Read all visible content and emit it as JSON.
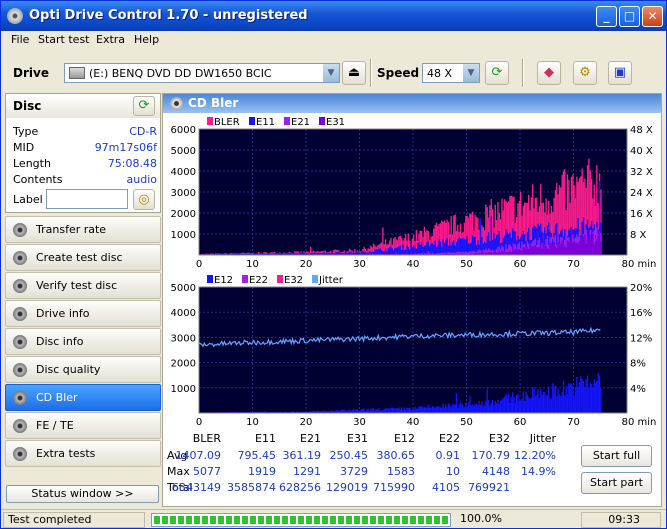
{
  "window": {
    "title": "Opti Drive Control 1.70 - unregistered",
    "min": "_",
    "max": "□",
    "close": "✕"
  },
  "menu": [
    "File",
    "Start test",
    "Extra",
    "Help"
  ],
  "toolbar": {
    "drive_label": "Drive",
    "drive_value": "(E:)  BENQ DVD DD DW1650 BCIC",
    "speed_label": "Speed",
    "speed_value": "48 X"
  },
  "disc": {
    "title": "Disc",
    "rows": [
      {
        "k": "Type",
        "v": "CD-R"
      },
      {
        "k": "MID",
        "v": "97m17s06f"
      },
      {
        "k": "Length",
        "v": "75:08.48"
      },
      {
        "k": "Contents",
        "v": "audio"
      }
    ],
    "label_caption": "Label",
    "label_value": ""
  },
  "nav": [
    "Transfer rate",
    "Create test disc",
    "Verify test disc",
    "Drive info",
    "Disc info",
    "Disc quality",
    "CD Bler",
    "FE / TE",
    "Extra tests"
  ],
  "nav_active": 6,
  "status_window_button": "Status window >>",
  "panel_title": "CD Bler",
  "chart_data": [
    {
      "type": "area",
      "legend": [
        "BLER",
        "E11",
        "E21",
        "E31"
      ],
      "colors": [
        "#ff1a8c",
        "#1414ff",
        "#a020f0",
        "#7b00d6"
      ],
      "x_ticks": [
        "0",
        "10",
        "20",
        "30",
        "40",
        "50",
        "60",
        "70",
        "80 min"
      ],
      "y_ticks": [
        "6000",
        "5000",
        "4000",
        "3000",
        "2000",
        "1000"
      ],
      "y2_ticks": [
        "48 X",
        "40 X",
        "32 X",
        "24 X",
        "16 X",
        "8 X"
      ],
      "xlim": [
        0,
        80
      ],
      "ylim": [
        0,
        6000
      ],
      "series": [
        {
          "name": "BLER",
          "x": [
            0,
            10,
            20,
            30,
            35,
            40,
            45,
            50,
            55,
            60,
            65,
            70,
            75
          ],
          "y": [
            50,
            100,
            150,
            250,
            600,
            900,
            1300,
            1700,
            2100,
            2500,
            2900,
            3300,
            3800
          ]
        },
        {
          "name": "E11",
          "x": [
            0,
            10,
            20,
            30,
            35,
            40,
            45,
            50,
            55,
            60,
            65,
            70,
            75
          ],
          "y": [
            30,
            60,
            100,
            150,
            300,
            450,
            600,
            750,
            900,
            1050,
            1200,
            1350,
            1500
          ]
        },
        {
          "name": "E21",
          "x": [
            0,
            30,
            40,
            50,
            55,
            60,
            65,
            70,
            75
          ],
          "y": [
            0,
            20,
            60,
            150,
            300,
            500,
            700,
            900,
            1100
          ]
        },
        {
          "name": "E31",
          "x": [
            0,
            50,
            55,
            60,
            65,
            70,
            75
          ],
          "y": [
            0,
            50,
            150,
            300,
            450,
            650,
            900
          ]
        }
      ]
    },
    {
      "type": "area",
      "legend": [
        "E12",
        "E22",
        "E32",
        "Jitter"
      ],
      "colors": [
        "#1414ff",
        "#a020f0",
        "#ff1a8c",
        "#5fa8ff"
      ],
      "x_ticks": [
        "0",
        "10",
        "20",
        "30",
        "40",
        "50",
        "60",
        "70",
        "80 min"
      ],
      "y_ticks": [
        "5000",
        "4000",
        "3000",
        "2000",
        "1000"
      ],
      "y2_ticks": [
        "20%",
        "16%",
        "12%",
        "8%",
        "4%"
      ],
      "xlim": [
        0,
        80
      ],
      "ylim": [
        0,
        5000
      ],
      "series": [
        {
          "name": "E12",
          "x": [
            0,
            20,
            40,
            50,
            55,
            60,
            65,
            70,
            75
          ],
          "y": [
            20,
            60,
            200,
            350,
            500,
            700,
            900,
            1100,
            1400
          ]
        },
        {
          "name": "Jitter",
          "x": [
            0,
            10,
            20,
            30,
            40,
            50,
            60,
            70,
            75
          ],
          "y": [
            10.8,
            11.2,
            11.5,
            11.8,
            12.2,
            12.4,
            12.6,
            12.8,
            13.2
          ]
        }
      ]
    }
  ],
  "stats": {
    "headers": [
      "BLER",
      "E11",
      "E21",
      "E31",
      "E12",
      "E22",
      "E32",
      "Jitter"
    ],
    "rows": [
      {
        "label": "Avg",
        "values": [
          "1407.09",
          "795.45",
          "361.19",
          "250.45",
          "380.65",
          "0.91",
          "170.79",
          "12.20%"
        ]
      },
      {
        "label": "Max",
        "values": [
          "5077",
          "1919",
          "1291",
          "3729",
          "1583",
          "10",
          "4148",
          "14.9%"
        ]
      },
      {
        "label": "Total",
        "values": [
          "6343149",
          "3585874",
          "628256",
          "129019",
          "715990",
          "4105",
          "769921",
          ""
        ]
      }
    ],
    "start_full": "Start full",
    "start_part": "Start part"
  },
  "statusbar": {
    "text": "Test completed",
    "progress": 100,
    "progress_text": "100.0%",
    "time": "09:33"
  }
}
